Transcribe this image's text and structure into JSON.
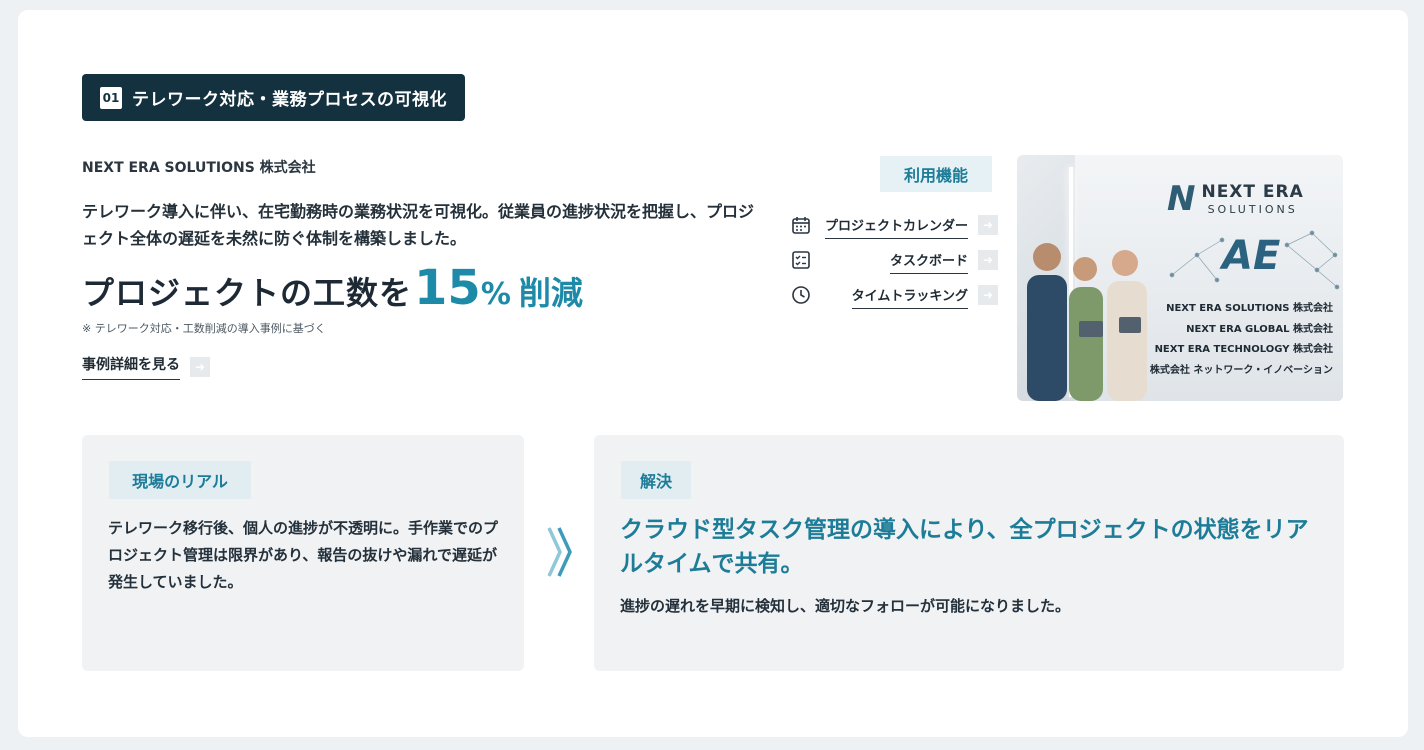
{
  "case": {
    "number": "01",
    "title": "テレワーク対応・業務プロセスの可視化"
  },
  "company": "NEXT ERA SOLUTIONS 株式会社",
  "description": "テレワーク導入に伴い、在宅勤務時の業務状況を可視化。従業員の進捗状況を把握し、プロジェクト全体の遅延を未然に防ぐ体制を構築しました。",
  "headline": {
    "prefix": "プロジェクトの工数を",
    "number": "15",
    "unit": "%",
    "suffix": "削減"
  },
  "note": "※ テレワーク対応・工数削減の導入事例に基づく",
  "detail_link": "事例詳細を見る",
  "features": {
    "tag": "利用機能",
    "items": [
      {
        "label": "プロジェクトカレンダー",
        "icon": "calendar-icon"
      },
      {
        "label": "タスクボード",
        "icon": "checklist-icon"
      },
      {
        "label": "タイムトラッキング",
        "icon": "clock-icon"
      }
    ]
  },
  "photo": {
    "brand_top": "NEXT ERA",
    "brand_bottom": "SOLUTIONS",
    "logo_letters": "AE",
    "groups": [
      "NEXT ERA SOLUTIONS 株式会社",
      "NEXT ERA GLOBAL 株式会社",
      "NEXT ERA TECHNOLOGY 株式会社",
      "株式会社 ネットワーク・イノベーション"
    ]
  },
  "reality": {
    "tag": "現場のリアル",
    "text": "テレワーク移行後、個人の進捗が不透明に。手作業でのプロジェクト管理は限界があり、報告の抜けや漏れで遅延が発生していました。"
  },
  "solution": {
    "tag": "解決",
    "headline": "クラウド型タスク管理の導入により、全プロジェクトの状態をリアルタイムで共有。",
    "text": "進捗の遅れを早期に検知し、適切なフォローが可能になりました。"
  },
  "colors": {
    "accent": "#1d8aa8",
    "dark_tag": "#14313f",
    "card_bg": "#f0f2f4"
  }
}
